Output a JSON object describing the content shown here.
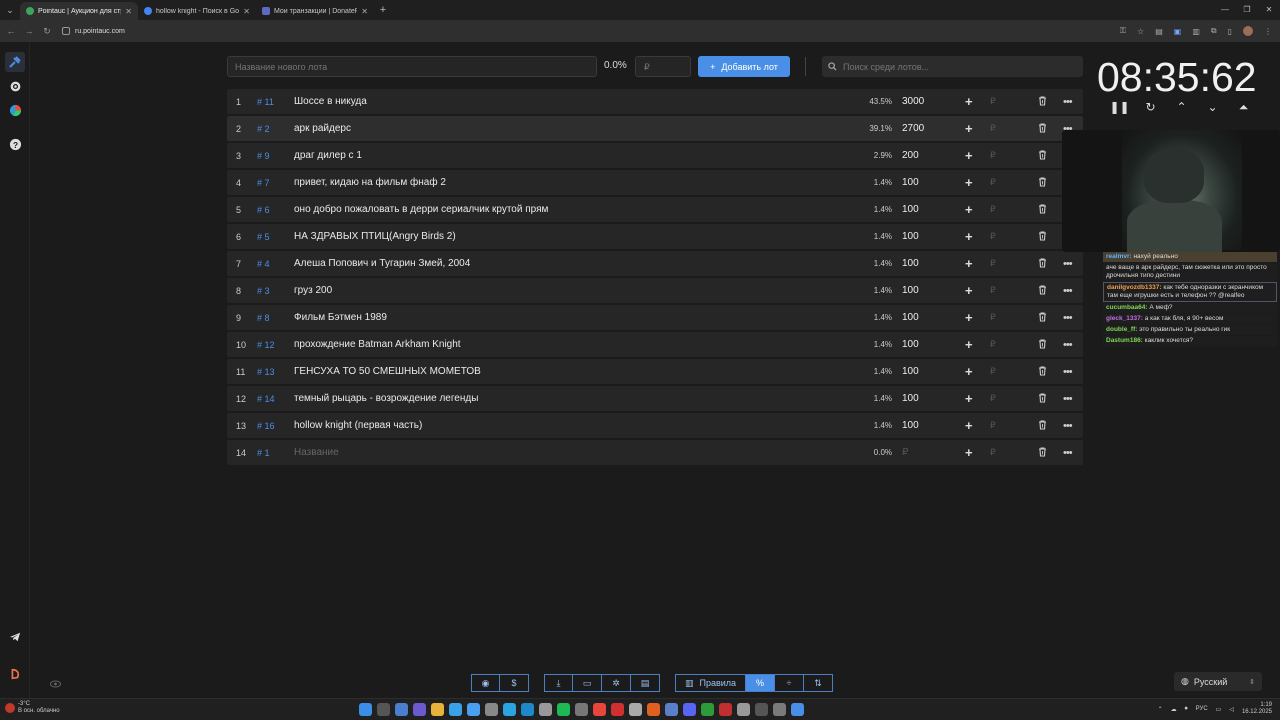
{
  "browser": {
    "tabs": [
      {
        "title": "Pointauc | Аукцион для стримо",
        "active": true,
        "favicon": "pointauc-icon"
      },
      {
        "title": "hollow knight - Поиск в Googl",
        "active": false,
        "favicon": "google-icon"
      },
      {
        "title": "Мои транзакции | DonatePay",
        "active": false,
        "favicon": "donatepay-icon"
      }
    ],
    "url": "ru.pointauc.com"
  },
  "toolbar": {
    "lot_name_placeholder": "Название нового лота",
    "percent": "0.0%",
    "price_placeholder": "₽",
    "add_label": "Добавить лот",
    "search_placeholder": "Поиск среди лотов..."
  },
  "lots": [
    {
      "idx": "1",
      "id": "# 11",
      "name": "Шоссе в никуда",
      "pct": "43.5%",
      "amount": "3000",
      "more": true
    },
    {
      "idx": "2",
      "id": "# 2",
      "name": "арк райдерс",
      "pct": "39.1%",
      "amount": "2700",
      "more": true
    },
    {
      "idx": "3",
      "id": "# 9",
      "name": "драг дилер с 1",
      "pct": "2.9%",
      "amount": "200",
      "more": false
    },
    {
      "idx": "4",
      "id": "# 7",
      "name": "привет, кидаю на фильм фнаф 2",
      "pct": "1.4%",
      "amount": "100",
      "more": false
    },
    {
      "idx": "5",
      "id": "# 6",
      "name": "оно добро пожаловать в дерри сериалчик крутой прям",
      "pct": "1.4%",
      "amount": "100",
      "more": false
    },
    {
      "idx": "6",
      "id": "# 5",
      "name": "НА ЗДРАВЫХ ПТИЦ(Angry Birds 2)",
      "pct": "1.4%",
      "amount": "100",
      "more": false
    },
    {
      "idx": "7",
      "id": "# 4",
      "name": "Алеша Попович и Тугарин Змей, 2004",
      "pct": "1.4%",
      "amount": "100",
      "more": true
    },
    {
      "idx": "8",
      "id": "# 3",
      "name": "груз 200",
      "pct": "1.4%",
      "amount": "100",
      "more": true
    },
    {
      "idx": "9",
      "id": "# 8",
      "name": "Фильм Бэтмен 1989",
      "pct": "1.4%",
      "amount": "100",
      "more": true
    },
    {
      "idx": "10",
      "id": "# 12",
      "name": "прохождение Batman Arkham Knight",
      "pct": "1.4%",
      "amount": "100",
      "more": true
    },
    {
      "idx": "11",
      "id": "# 13",
      "name": "ГЕНСУХА ТО 50 СМЕШНЫХ МОМЕТОВ",
      "pct": "1.4%",
      "amount": "100",
      "more": true
    },
    {
      "idx": "12",
      "id": "# 14",
      "name": "темный рыцарь - возрождение легенды",
      "pct": "1.4%",
      "amount": "100",
      "more": true
    },
    {
      "idx": "13",
      "id": "# 16",
      "name": "hollow knight (первая часть)",
      "pct": "1.4%",
      "amount": "100",
      "more": true
    },
    {
      "idx": "14",
      "id": "# 1",
      "name": "Название",
      "pct": "0.0%",
      "amount": "₽",
      "more": true,
      "placeholder": true
    }
  ],
  "timer": {
    "display": "08:35:62"
  },
  "chat": [
    {
      "user": "realmvr:",
      "text": "нахуй реально",
      "color": "#5ab4ff"
    },
    {
      "user": "",
      "text": "аче ваще в арк райдерс, там сюжетка или это просто дрочильня типо дестини",
      "color": "#d04040"
    },
    {
      "user": "danilgvozdb1337:",
      "text": "как тебе одноразки с экранчиком там еще игрушки есть и телефон ?? @realfeo",
      "color": "#f0a050"
    },
    {
      "user": "cucumbaa64:",
      "text": "А меф?",
      "color": "#7ed957"
    },
    {
      "user": "gleck_1337:",
      "text": "а как так бля, я 90+ весом",
      "color": "#c070e0"
    },
    {
      "user": "double_ff:",
      "text": "это правильно ты реально гик",
      "color": "#7ed957"
    },
    {
      "user": "Dastum186:",
      "text": "каклик хочется?",
      "color": "#7ed957"
    }
  ],
  "bottom": {
    "rules_label": "Правила",
    "language": "Русский"
  },
  "taskbar": {
    "weather_temp": "-3°C",
    "weather_desc": "В осн. облачно",
    "lang": "РУС",
    "time": "1:19",
    "date": "16.12.2025"
  },
  "colors": {
    "accent": "#4a8fe7",
    "row_bg": "#262626",
    "page_bg": "#1b1b1b"
  }
}
